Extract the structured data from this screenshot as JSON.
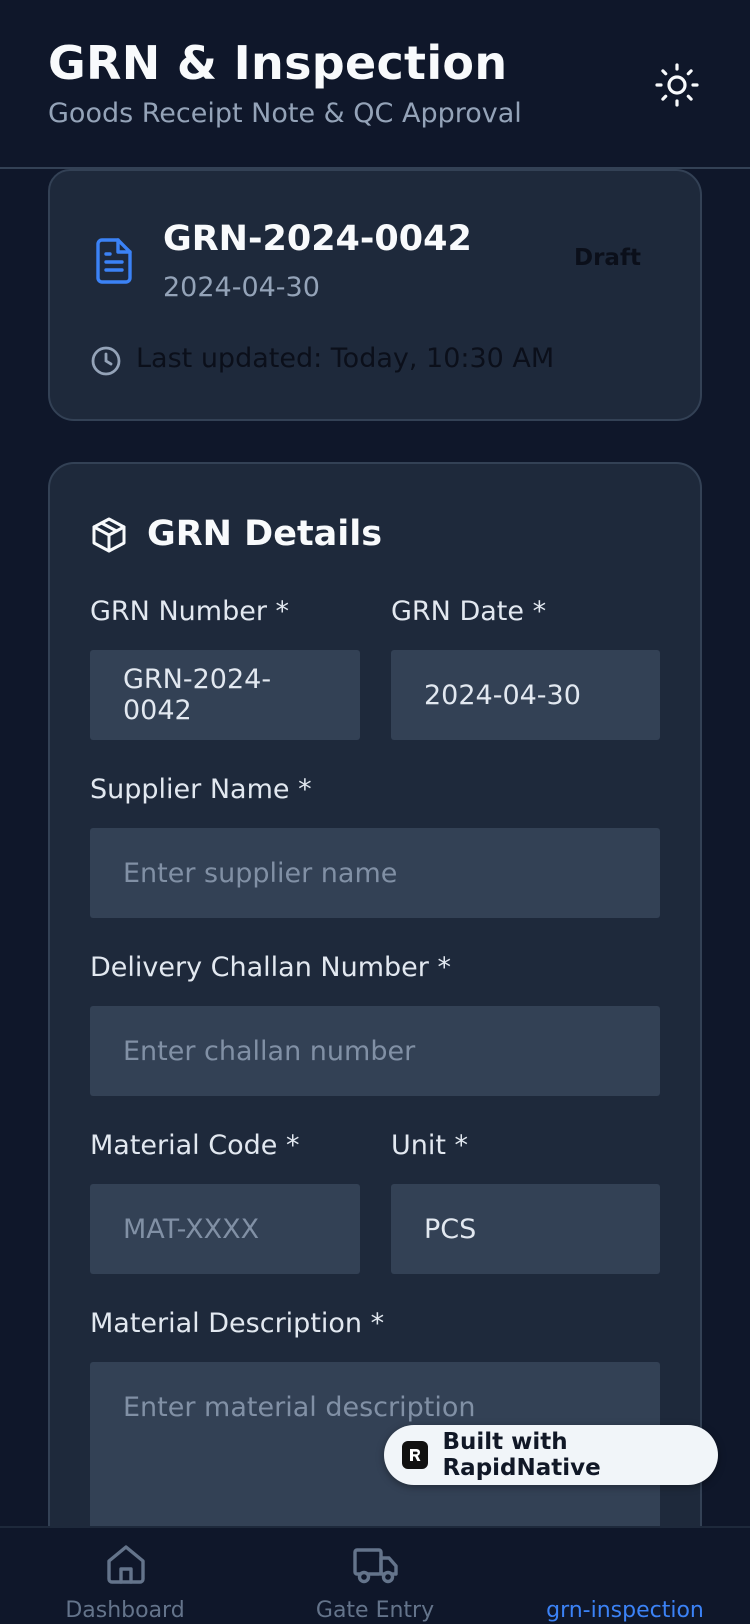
{
  "header": {
    "title": "GRN & Inspection",
    "subtitle": "Goods Receipt Note & QC Approval",
    "theme_icon": "sun-icon"
  },
  "summary": {
    "grn_number": "GRN-2024-0042",
    "grn_date": "2024-04-30",
    "status": "Draft",
    "last_updated": "Last updated: Today, 10:30 AM"
  },
  "details": {
    "section_title": "GRN Details",
    "grn_number_label": "GRN Number *",
    "grn_number_value": "GRN-2024-0042",
    "grn_date_label": "GRN Date *",
    "grn_date_value": "2024-04-30",
    "supplier_label": "Supplier Name *",
    "supplier_placeholder": "Enter supplier name",
    "challan_label": "Delivery Challan Number *",
    "challan_placeholder": "Enter challan number",
    "material_code_label": "Material Code *",
    "material_code_placeholder": "MAT-XXXX",
    "unit_label": "Unit *",
    "unit_value": "PCS",
    "description_label": "Material Description *",
    "description_placeholder": "Enter material description"
  },
  "badge": {
    "label": "Built with RapidNative"
  },
  "tabs": [
    {
      "label": "Dashboard",
      "icon": "home-icon",
      "active": false
    },
    {
      "label": "Gate Entry",
      "icon": "truck-icon",
      "active": false
    },
    {
      "label": "grn-inspection",
      "icon": "",
      "active": true
    }
  ],
  "colors": {
    "background": "#0f172a",
    "card": "#1e293b",
    "input": "#334155",
    "accent": "#3b82f6",
    "muted": "#94a3b8"
  }
}
